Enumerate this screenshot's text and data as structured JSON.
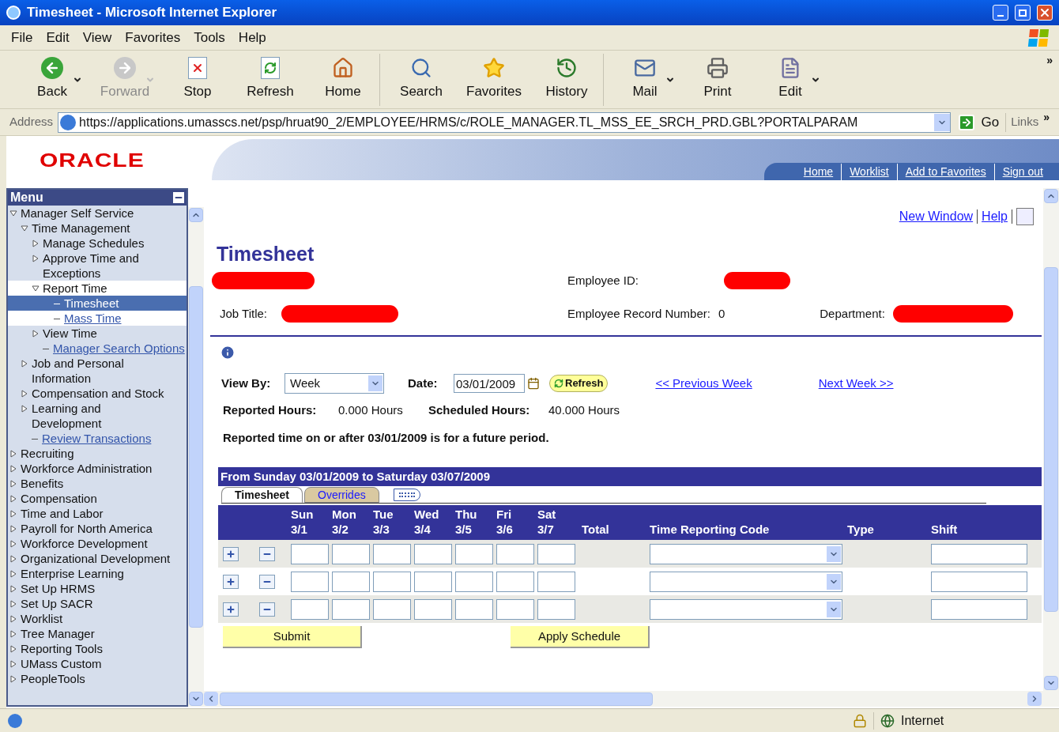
{
  "window": {
    "title": "Timesheet - Microsoft Internet Explorer"
  },
  "menu_bar": [
    "File",
    "Edit",
    "View",
    "Favorites",
    "Tools",
    "Help"
  ],
  "toolbar": [
    [
      {
        "label": "Back",
        "disabled": false,
        "dropdown": true
      },
      {
        "label": "Forward",
        "disabled": true,
        "dropdown": true
      },
      {
        "label": "Stop",
        "disabled": false,
        "dropdown": false
      },
      {
        "label": "Refresh",
        "disabled": false,
        "dropdown": false
      },
      {
        "label": "Home",
        "disabled": false,
        "dropdown": false
      }
    ],
    [
      {
        "label": "Search",
        "disabled": false,
        "dropdown": false
      },
      {
        "label": "Favorites",
        "disabled": false,
        "dropdown": false
      },
      {
        "label": "History",
        "disabled": false,
        "dropdown": false
      }
    ],
    [
      {
        "label": "Mail",
        "disabled": false,
        "dropdown": true
      },
      {
        "label": "Print",
        "disabled": false,
        "dropdown": false
      },
      {
        "label": "Edit",
        "disabled": false,
        "dropdown": true
      }
    ]
  ],
  "toolbar_overflow": "»",
  "address_bar": {
    "label": "Address",
    "url": "https://applications.umasscs.net/psp/hruat90_2/EMPLOYEE/HRMS/c/ROLE_MANAGER.TL_MSS_EE_SRCH_PRD.GBL?PORTALPARAM",
    "go": "Go",
    "links": "Links",
    "links_overflow": "»"
  },
  "header": {
    "logo": "ORACLE",
    "links": [
      "Home",
      "Worklist",
      "Add to Favorites",
      "Sign out"
    ]
  },
  "sidebar": {
    "title": "Menu",
    "items": [
      {
        "label": "Manager Self Service",
        "kind": "folder",
        "expanded": true,
        "selected": false,
        "children": [
          {
            "label": "Time Management",
            "kind": "folder",
            "expanded": true,
            "selected": false,
            "children": [
              {
                "label": "Manage Schedules",
                "kind": "folder",
                "expanded": false,
                "selected": false
              },
              {
                "label": "Approve Time and Exceptions",
                "kind": "folder",
                "expanded": false,
                "selected": false
              },
              {
                "label": "Report Time",
                "kind": "folder",
                "expanded": true,
                "selected": false,
                "children": [
                  {
                    "label": "Timesheet",
                    "kind": "link",
                    "selected": true
                  },
                  {
                    "label": "Mass Time",
                    "kind": "link",
                    "selected": false
                  }
                ]
              },
              {
                "label": "View Time",
                "kind": "folder",
                "expanded": false,
                "selected": false
              },
              {
                "label": "Manager Search Options",
                "kind": "link",
                "selected": false
              }
            ]
          },
          {
            "label": "Job and Personal Information",
            "kind": "folder",
            "expanded": false,
            "selected": false
          },
          {
            "label": "Compensation and Stock",
            "kind": "folder",
            "expanded": false,
            "selected": false
          },
          {
            "label": "Learning and Development",
            "kind": "folder",
            "expanded": false,
            "selected": false
          },
          {
            "label": "Review Transactions",
            "kind": "link",
            "selected": false
          }
        ]
      },
      {
        "label": "Recruiting",
        "kind": "folder",
        "expanded": false,
        "selected": false
      },
      {
        "label": "Workforce Administration",
        "kind": "folder",
        "expanded": false,
        "selected": false
      },
      {
        "label": "Benefits",
        "kind": "folder",
        "expanded": false,
        "selected": false
      },
      {
        "label": "Compensation",
        "kind": "folder",
        "expanded": false,
        "selected": false
      },
      {
        "label": "Time and Labor",
        "kind": "folder",
        "expanded": false,
        "selected": false
      },
      {
        "label": "Payroll for North America",
        "kind": "folder",
        "expanded": false,
        "selected": false
      },
      {
        "label": "Workforce Development",
        "kind": "folder",
        "expanded": false,
        "selected": false
      },
      {
        "label": "Organizational Development",
        "kind": "folder",
        "expanded": false,
        "selected": false
      },
      {
        "label": "Enterprise Learning",
        "kind": "folder",
        "expanded": false,
        "selected": false
      },
      {
        "label": "Set Up HRMS",
        "kind": "folder",
        "expanded": false,
        "selected": false
      },
      {
        "label": "Set Up SACR",
        "kind": "folder",
        "expanded": false,
        "selected": false
      },
      {
        "label": "Worklist",
        "kind": "folder",
        "expanded": false,
        "selected": false
      },
      {
        "label": "Tree Manager",
        "kind": "folder",
        "expanded": false,
        "selected": false
      },
      {
        "label": "Reporting Tools",
        "kind": "folder",
        "expanded": false,
        "selected": false
      },
      {
        "label": "UMass Custom",
        "kind": "folder",
        "expanded": false,
        "selected": false
      },
      {
        "label": "PeopleTools",
        "kind": "folder",
        "expanded": false,
        "selected": false
      }
    ]
  },
  "page_links": [
    "New Window",
    "Help"
  ],
  "page": {
    "title": "Timesheet",
    "employee": {
      "employee_id_label": "Employee ID:",
      "job_title_label": "Job Title:",
      "record_label": "Employee Record Number:",
      "record_value": "0",
      "department_label": "Department:"
    },
    "view_by": {
      "label": "View By:",
      "value": "Week"
    },
    "date": {
      "label": "Date:",
      "value": "03/01/2009"
    },
    "refresh": "Refresh",
    "previous": "<< Previous Week",
    "next": "Next Week >>",
    "reported_label": "Reported Hours:",
    "reported_value": "0.000 Hours",
    "scheduled_label": "Scheduled Hours:",
    "scheduled_value": "40.000 Hours",
    "notice": "Reported time on or after 03/01/2009 is for a future period.",
    "period": "From Sunday 03/01/2009 to Saturday 03/07/2009",
    "tabs": [
      {
        "label": "Timesheet",
        "selected": true
      },
      {
        "label": "Overrides",
        "selected": false
      }
    ],
    "days": [
      {
        "day": "Sun",
        "date": "3/1"
      },
      {
        "day": "Mon",
        "date": "3/2"
      },
      {
        "day": "Tue",
        "date": "3/3"
      },
      {
        "day": "Wed",
        "date": "3/4"
      },
      {
        "day": "Thu",
        "date": "3/5"
      },
      {
        "day": "Fri",
        "date": "3/6"
      },
      {
        "day": "Sat",
        "date": "3/7"
      }
    ],
    "columns": [
      "Total",
      "Time Reporting Code",
      "Type",
      "Shift"
    ],
    "rows": [
      {
        "striped": true
      },
      {
        "striped": false
      },
      {
        "striped": true
      }
    ],
    "buttons": [
      "Submit",
      "Apply Schedule"
    ]
  },
  "status_bar": {
    "zone": "Internet"
  }
}
